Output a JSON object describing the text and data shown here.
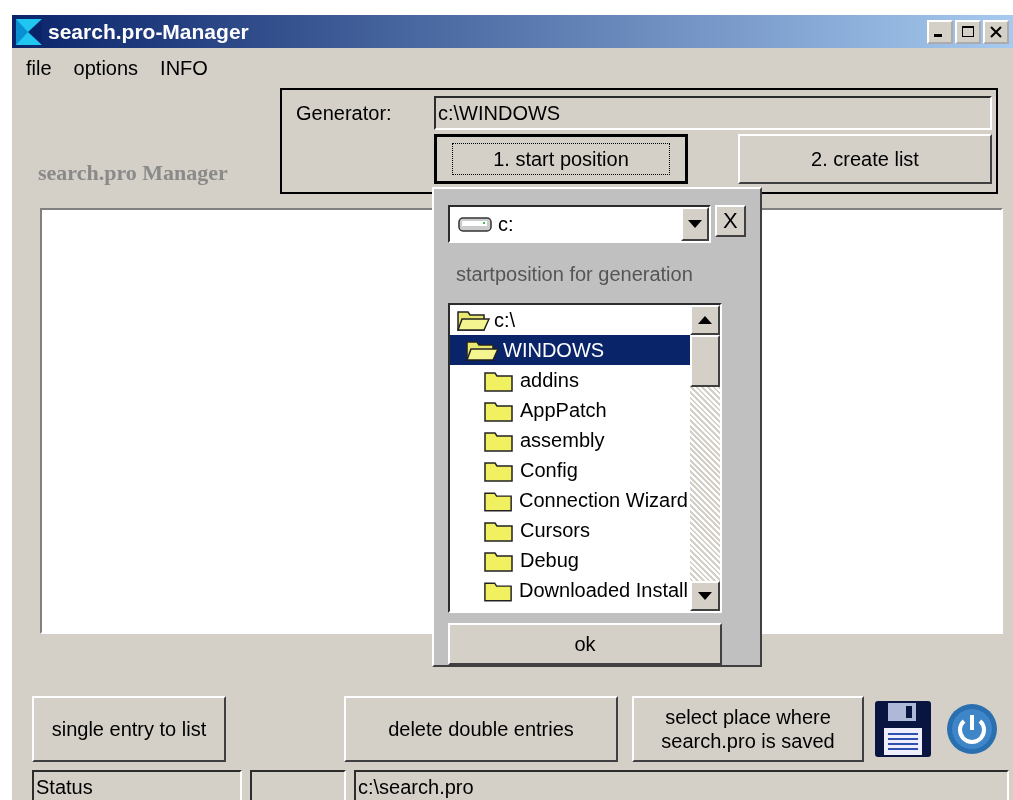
{
  "window": {
    "title": "search.pro-Manager"
  },
  "menu": [
    "file",
    "options",
    "INFO"
  ],
  "app_label": "search.pro Manager",
  "generator": {
    "label": "Generator:",
    "path": "c:\\WINDOWS",
    "buttons": [
      {
        "label": "1. start position",
        "focused": true
      },
      {
        "label": "2. create list",
        "focused": false
      }
    ]
  },
  "popup": {
    "drive": "c:",
    "close": "X",
    "label": "startposition for generation",
    "ok": "ok",
    "tree": [
      {
        "name": "c:\\",
        "expanded": true,
        "selected": false,
        "children": [
          {
            "name": "WINDOWS",
            "expanded": true,
            "selected": true,
            "children": [
              {
                "name": "addins",
                "expanded": false,
                "selected": false
              },
              {
                "name": "AppPatch",
                "expanded": false,
                "selected": false
              },
              {
                "name": "assembly",
                "expanded": false,
                "selected": false
              },
              {
                "name": "Config",
                "expanded": false,
                "selected": false
              },
              {
                "name": "Connection Wizard",
                "expanded": false,
                "selected": false
              },
              {
                "name": "Cursors",
                "expanded": false,
                "selected": false
              },
              {
                "name": "Debug",
                "expanded": false,
                "selected": false
              },
              {
                "name": "Downloaded Install",
                "expanded": false,
                "selected": false
              }
            ]
          }
        ]
      }
    ]
  },
  "buttons": [
    "single entry to list",
    "delete double entries",
    "select place where search.pro is saved"
  ],
  "status_bar": {
    "status": "Status",
    "path": "c:\\search.pro"
  }
}
